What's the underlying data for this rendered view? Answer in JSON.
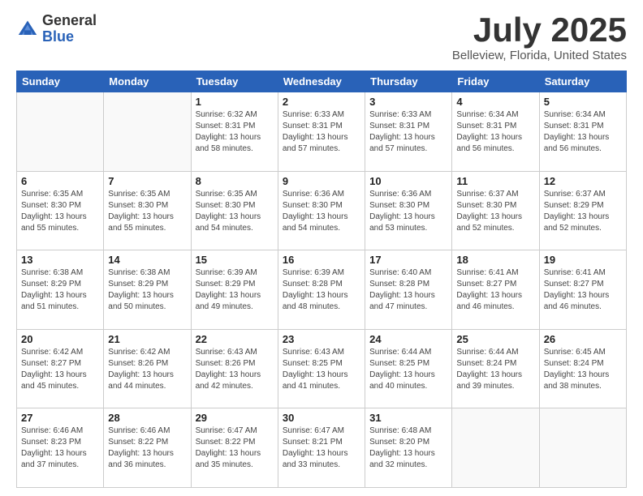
{
  "header": {
    "logo_general": "General",
    "logo_blue": "Blue",
    "month_title": "July 2025",
    "location": "Belleview, Florida, United States"
  },
  "days_of_week": [
    "Sunday",
    "Monday",
    "Tuesday",
    "Wednesday",
    "Thursday",
    "Friday",
    "Saturday"
  ],
  "weeks": [
    [
      {
        "day": "",
        "sunrise": "",
        "sunset": "",
        "daylight": ""
      },
      {
        "day": "",
        "sunrise": "",
        "sunset": "",
        "daylight": ""
      },
      {
        "day": "1",
        "sunrise": "Sunrise: 6:32 AM",
        "sunset": "Sunset: 8:31 PM",
        "daylight": "Daylight: 13 hours and 58 minutes."
      },
      {
        "day": "2",
        "sunrise": "Sunrise: 6:33 AM",
        "sunset": "Sunset: 8:31 PM",
        "daylight": "Daylight: 13 hours and 57 minutes."
      },
      {
        "day": "3",
        "sunrise": "Sunrise: 6:33 AM",
        "sunset": "Sunset: 8:31 PM",
        "daylight": "Daylight: 13 hours and 57 minutes."
      },
      {
        "day": "4",
        "sunrise": "Sunrise: 6:34 AM",
        "sunset": "Sunset: 8:31 PM",
        "daylight": "Daylight: 13 hours and 56 minutes."
      },
      {
        "day": "5",
        "sunrise": "Sunrise: 6:34 AM",
        "sunset": "Sunset: 8:31 PM",
        "daylight": "Daylight: 13 hours and 56 minutes."
      }
    ],
    [
      {
        "day": "6",
        "sunrise": "Sunrise: 6:35 AM",
        "sunset": "Sunset: 8:30 PM",
        "daylight": "Daylight: 13 hours and 55 minutes."
      },
      {
        "day": "7",
        "sunrise": "Sunrise: 6:35 AM",
        "sunset": "Sunset: 8:30 PM",
        "daylight": "Daylight: 13 hours and 55 minutes."
      },
      {
        "day": "8",
        "sunrise": "Sunrise: 6:35 AM",
        "sunset": "Sunset: 8:30 PM",
        "daylight": "Daylight: 13 hours and 54 minutes."
      },
      {
        "day": "9",
        "sunrise": "Sunrise: 6:36 AM",
        "sunset": "Sunset: 8:30 PM",
        "daylight": "Daylight: 13 hours and 54 minutes."
      },
      {
        "day": "10",
        "sunrise": "Sunrise: 6:36 AM",
        "sunset": "Sunset: 8:30 PM",
        "daylight": "Daylight: 13 hours and 53 minutes."
      },
      {
        "day": "11",
        "sunrise": "Sunrise: 6:37 AM",
        "sunset": "Sunset: 8:30 PM",
        "daylight": "Daylight: 13 hours and 52 minutes."
      },
      {
        "day": "12",
        "sunrise": "Sunrise: 6:37 AM",
        "sunset": "Sunset: 8:29 PM",
        "daylight": "Daylight: 13 hours and 52 minutes."
      }
    ],
    [
      {
        "day": "13",
        "sunrise": "Sunrise: 6:38 AM",
        "sunset": "Sunset: 8:29 PM",
        "daylight": "Daylight: 13 hours and 51 minutes."
      },
      {
        "day": "14",
        "sunrise": "Sunrise: 6:38 AM",
        "sunset": "Sunset: 8:29 PM",
        "daylight": "Daylight: 13 hours and 50 minutes."
      },
      {
        "day": "15",
        "sunrise": "Sunrise: 6:39 AM",
        "sunset": "Sunset: 8:29 PM",
        "daylight": "Daylight: 13 hours and 49 minutes."
      },
      {
        "day": "16",
        "sunrise": "Sunrise: 6:39 AM",
        "sunset": "Sunset: 8:28 PM",
        "daylight": "Daylight: 13 hours and 48 minutes."
      },
      {
        "day": "17",
        "sunrise": "Sunrise: 6:40 AM",
        "sunset": "Sunset: 8:28 PM",
        "daylight": "Daylight: 13 hours and 47 minutes."
      },
      {
        "day": "18",
        "sunrise": "Sunrise: 6:41 AM",
        "sunset": "Sunset: 8:27 PM",
        "daylight": "Daylight: 13 hours and 46 minutes."
      },
      {
        "day": "19",
        "sunrise": "Sunrise: 6:41 AM",
        "sunset": "Sunset: 8:27 PM",
        "daylight": "Daylight: 13 hours and 46 minutes."
      }
    ],
    [
      {
        "day": "20",
        "sunrise": "Sunrise: 6:42 AM",
        "sunset": "Sunset: 8:27 PM",
        "daylight": "Daylight: 13 hours and 45 minutes."
      },
      {
        "day": "21",
        "sunrise": "Sunrise: 6:42 AM",
        "sunset": "Sunset: 8:26 PM",
        "daylight": "Daylight: 13 hours and 44 minutes."
      },
      {
        "day": "22",
        "sunrise": "Sunrise: 6:43 AM",
        "sunset": "Sunset: 8:26 PM",
        "daylight": "Daylight: 13 hours and 42 minutes."
      },
      {
        "day": "23",
        "sunrise": "Sunrise: 6:43 AM",
        "sunset": "Sunset: 8:25 PM",
        "daylight": "Daylight: 13 hours and 41 minutes."
      },
      {
        "day": "24",
        "sunrise": "Sunrise: 6:44 AM",
        "sunset": "Sunset: 8:25 PM",
        "daylight": "Daylight: 13 hours and 40 minutes."
      },
      {
        "day": "25",
        "sunrise": "Sunrise: 6:44 AM",
        "sunset": "Sunset: 8:24 PM",
        "daylight": "Daylight: 13 hours and 39 minutes."
      },
      {
        "day": "26",
        "sunrise": "Sunrise: 6:45 AM",
        "sunset": "Sunset: 8:24 PM",
        "daylight": "Daylight: 13 hours and 38 minutes."
      }
    ],
    [
      {
        "day": "27",
        "sunrise": "Sunrise: 6:46 AM",
        "sunset": "Sunset: 8:23 PM",
        "daylight": "Daylight: 13 hours and 37 minutes."
      },
      {
        "day": "28",
        "sunrise": "Sunrise: 6:46 AM",
        "sunset": "Sunset: 8:22 PM",
        "daylight": "Daylight: 13 hours and 36 minutes."
      },
      {
        "day": "29",
        "sunrise": "Sunrise: 6:47 AM",
        "sunset": "Sunset: 8:22 PM",
        "daylight": "Daylight: 13 hours and 35 minutes."
      },
      {
        "day": "30",
        "sunrise": "Sunrise: 6:47 AM",
        "sunset": "Sunset: 8:21 PM",
        "daylight": "Daylight: 13 hours and 33 minutes."
      },
      {
        "day": "31",
        "sunrise": "Sunrise: 6:48 AM",
        "sunset": "Sunset: 8:20 PM",
        "daylight": "Daylight: 13 hours and 32 minutes."
      },
      {
        "day": "",
        "sunrise": "",
        "sunset": "",
        "daylight": ""
      },
      {
        "day": "",
        "sunrise": "",
        "sunset": "",
        "daylight": ""
      }
    ]
  ]
}
